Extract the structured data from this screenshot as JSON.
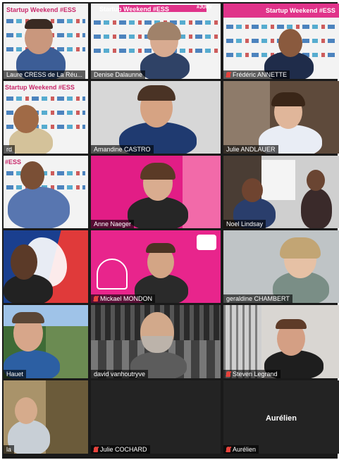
{
  "banner": {
    "title": "Startup Weekend #ESS",
    "tag": "#ESS",
    "jury_tag": "#JURY"
  },
  "participants": [
    {
      "label": "Laure CRESS de La Réu...",
      "muted": false,
      "center": ""
    },
    {
      "label": "Denise Dalaunne",
      "muted": false,
      "center": ""
    },
    {
      "label": "Frédéric ANNETTE",
      "muted": true,
      "center": ""
    },
    {
      "label": "rd",
      "muted": false,
      "center": ""
    },
    {
      "label": "Amandine CASTRO",
      "muted": false,
      "center": ""
    },
    {
      "label": "Julie ANDLAUER",
      "muted": false,
      "center": ""
    },
    {
      "label": "",
      "muted": false,
      "center": ""
    },
    {
      "label": "Anne Naeger",
      "muted": false,
      "center": ""
    },
    {
      "label": "Noel Lindsay",
      "muted": false,
      "center": ""
    },
    {
      "label": "",
      "muted": false,
      "center": ""
    },
    {
      "label": "Mickael MONDON",
      "muted": true,
      "center": ""
    },
    {
      "label": "geraldine CHAMBERT",
      "muted": false,
      "center": ""
    },
    {
      "label": "Hauet",
      "muted": false,
      "center": ""
    },
    {
      "label": "david vanhoutryve",
      "muted": false,
      "center": ""
    },
    {
      "label": "Steven Legrand",
      "muted": true,
      "center": ""
    },
    {
      "label": "la",
      "muted": false,
      "center": ""
    },
    {
      "label": "Julie COCHARD",
      "muted": true,
      "center": ""
    },
    {
      "label": "Aurélien",
      "muted": true,
      "center": "Aurélien"
    }
  ],
  "colors": {
    "brand_pink": "#e0338a",
    "mute_red": "#e8433c",
    "grid_bg": "#1a1a1a"
  },
  "icons": {
    "mute": "muted-microphone-icon"
  }
}
